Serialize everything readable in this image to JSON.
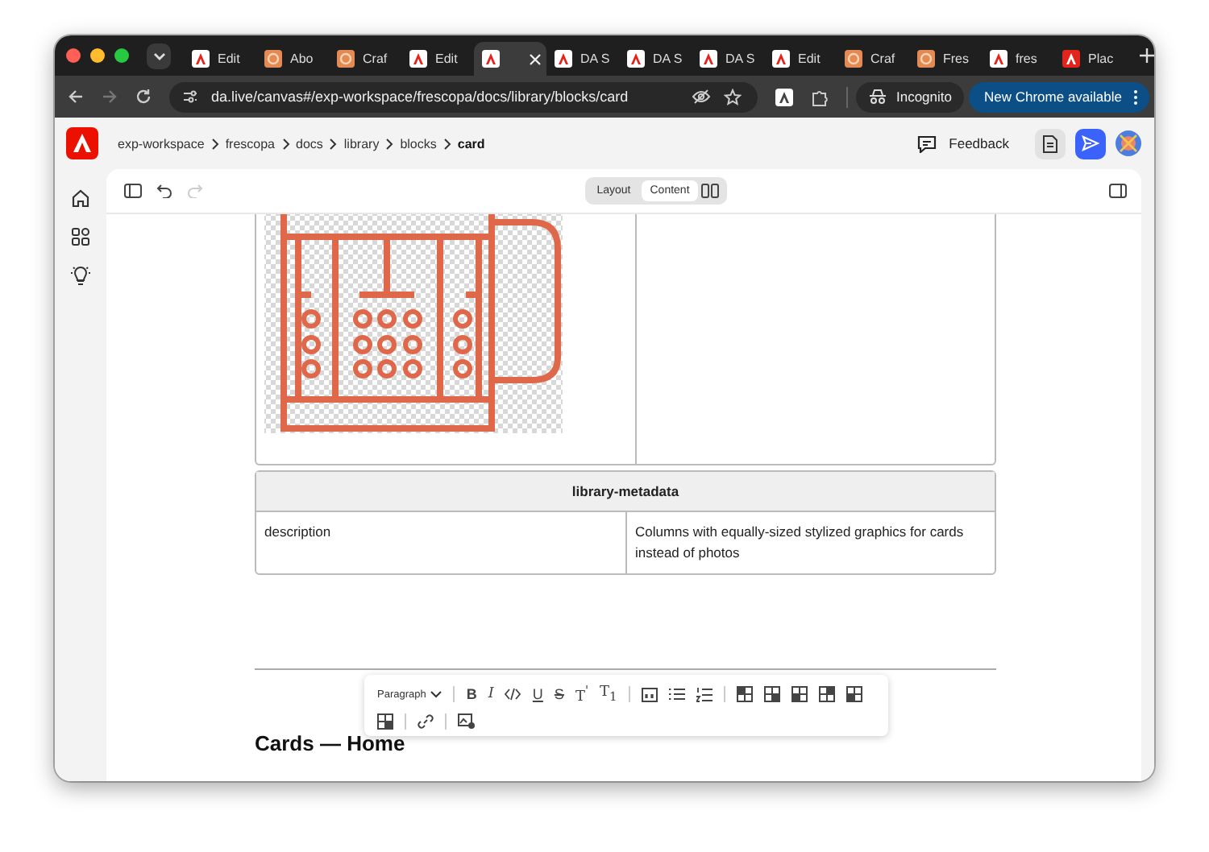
{
  "browser": {
    "tabs": [
      {
        "label": "Edit",
        "kind": "adobe",
        "selected": false
      },
      {
        "label": "Abo",
        "kind": "frescopa",
        "selected": false
      },
      {
        "label": "Craf",
        "kind": "frescopa",
        "selected": false
      },
      {
        "label": "Edit",
        "kind": "adobe",
        "selected": false
      },
      {
        "kind": "adobe",
        "selected": true
      },
      {
        "label": "DA S",
        "kind": "adobe",
        "selected": false
      },
      {
        "label": "DA S",
        "kind": "adobe",
        "selected": false
      },
      {
        "label": "DA S",
        "kind": "adobe",
        "selected": false
      },
      {
        "label": "Edit",
        "kind": "adobe",
        "selected": false
      },
      {
        "label": "Craf",
        "kind": "frescopa",
        "selected": false
      },
      {
        "label": "Fres",
        "kind": "frescopa",
        "selected": false
      },
      {
        "label": "fres",
        "kind": "adobe",
        "selected": false
      },
      {
        "label": "Plac",
        "kind": "redmark",
        "selected": false
      }
    ],
    "address": "da.live/canvas#/exp-workspace/frescopa/docs/library/blocks/card",
    "incognito": "Incognito",
    "update_button": "New Chrome available"
  },
  "app": {
    "breadcrumbs": [
      {
        "label": "exp-workspace",
        "current": false
      },
      {
        "label": "frescopa",
        "current": false
      },
      {
        "label": "docs",
        "current": false
      },
      {
        "label": "library",
        "current": false
      },
      {
        "label": "blocks",
        "current": false
      },
      {
        "label": "card",
        "current": true
      }
    ],
    "feedback": "Feedback"
  },
  "view_toggle": [
    {
      "label": "Layout",
      "selected": false
    },
    {
      "label": "Content",
      "selected": true
    }
  ],
  "document": {
    "metadata_table": {
      "title": "library-metadata",
      "rows": [
        [
          "description",
          "Columns with equally-sized stylized graphics for cards instead of photos"
        ]
      ]
    },
    "heading": "Cards — Home"
  },
  "format_toolbar": {
    "block_type": "Paragraph",
    "buttons": [
      {
        "kind": "text",
        "label": "B"
      },
      {
        "kind": "text",
        "label": "I"
      },
      {
        "kind": "code"
      },
      {
        "kind": "text",
        "label": "U"
      },
      {
        "kind": "text",
        "label": "S"
      },
      {
        "kind": "text",
        "label": "T$^{'}$"
      },
      {
        "kind": "text",
        "label": "T$_{1}$"
      },
      {
        "kind": "separator"
      },
      {
        "kind": "quote"
      },
      {
        "kind": "bullets"
      },
      {
        "kind": "numbers"
      },
      {
        "kind": "separator"
      },
      {
        "kind": "table"
      },
      {
        "kind": "table"
      },
      {
        "kind": "table"
      },
      {
        "kind": "table"
      },
      {
        "kind": "table"
      },
      {
        "kind": "table"
      },
      {
        "kind": "separator"
      },
      {
        "kind": "link"
      },
      {
        "kind": "separator"
      },
      {
        "kind": "image"
      }
    ]
  }
}
